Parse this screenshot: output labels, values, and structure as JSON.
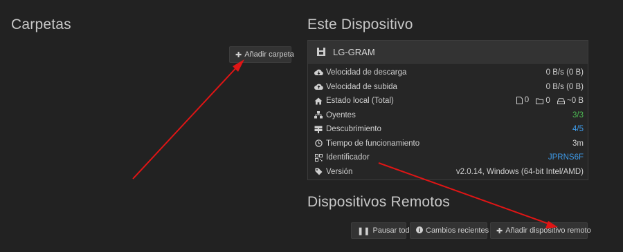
{
  "folders": {
    "title": "Carpetas",
    "add_button": "Añadir carpeta"
  },
  "device": {
    "section_title": "Este Dispositivo",
    "name": "LG-GRAM",
    "rows": [
      {
        "label": "Velocidad de descarga",
        "value": "0 B/s (0 B)",
        "icon": "cloud-download-icon"
      },
      {
        "label": "Velocidad de subida",
        "value": "0 B/s (0 B)",
        "icon": "cloud-upload-icon"
      },
      {
        "label": "Estado local (Total)",
        "files": "0",
        "dirs": "0",
        "size": "~0 B",
        "icon": "home-icon"
      },
      {
        "label": "Oyentes",
        "value": "3/3",
        "icon": "sitemap-icon",
        "color": "#4dbb53"
      },
      {
        "label": "Descubrimiento",
        "value": "4/5",
        "icon": "signpost-icon",
        "color": "#3e9ae8"
      },
      {
        "label": "Tiempo de funcionamiento",
        "value": "3m",
        "icon": "clock-icon"
      },
      {
        "label": "Identificador",
        "value": "JPRNS6F",
        "icon": "qrcode-icon",
        "color": "#3e9ae8"
      },
      {
        "label": "Versión",
        "value": "v2.0.14, Windows (64-bit Intel/AMD)",
        "icon": "tag-icon"
      }
    ]
  },
  "remote": {
    "section_title": "Dispositivos Remotos",
    "pause_all": "Pausar todo",
    "recent_changes": "Cambios recientes",
    "add_remote": "Añadir dispositivo remoto"
  },
  "annotation_color": "#e01515"
}
